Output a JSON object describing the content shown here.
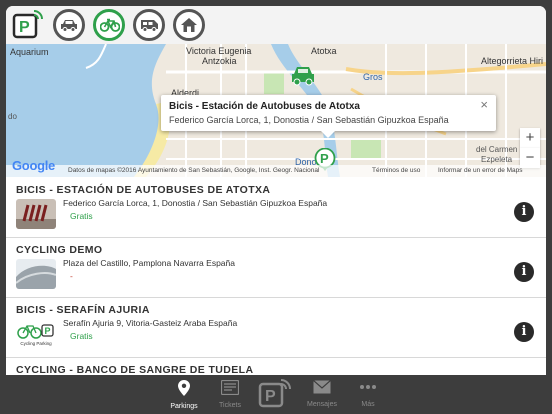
{
  "toolbar": {
    "categories": [
      {
        "name": "car",
        "active": false
      },
      {
        "name": "bicycle",
        "active": true
      },
      {
        "name": "van",
        "active": false
      },
      {
        "name": "home",
        "active": false
      }
    ]
  },
  "map": {
    "labels": {
      "aquarium": "Aquarium",
      "victoria_eugenia": "Victoria Eugenia",
      "antzokia": "Antzokia",
      "alderdi": "Alderdi",
      "gros": "Gros",
      "atotxa": "Atotxa",
      "altegorrieta": "Altegorrieta Hiri",
      "del_carmen": "del Carmen",
      "ezpeleta": "Ezpeleta",
      "do": "do",
      "donostia": "Dono"
    },
    "info_window": {
      "title": "Bicis - Estación de Autobuses de Atotxa",
      "address": "Federico García Lorca, 1, Donostia / San Sebastián Gipuzkoa España",
      "close": "×"
    },
    "zoom_in": "+",
    "zoom_out": "−",
    "google": "Google",
    "attribution": "Datos de mapas ©2016 Ayuntamiento de San Sebastián, Google, Inst. Geogr. Nacional",
    "terms": "Términos de uso",
    "report": "Informar de un error de Maps"
  },
  "parkings": [
    {
      "title": "BICIS - ESTACIÓN DE AUTOBUSES DE ATOTXA",
      "address": "Federico García Lorca, 1, Donostia / San Sebastián Gipuzkoa España",
      "price": "Gratis"
    },
    {
      "title": "CYCLING DEMO",
      "address": "Plaza del Castillo, Pamplona Navarra España",
      "price": "-"
    },
    {
      "title": "BICIS - SERAFÍN AJURIA",
      "address": "Serafín Ajuria 9, Vitoria-Gasteiz Araba España",
      "price": "Gratis"
    },
    {
      "title": "CYCLING - BANCO DE SANGRE DE TUDELA",
      "address": "",
      "price": ""
    }
  ],
  "thumb3_text": "Cycling Parking",
  "nav": {
    "tabs": [
      {
        "label": "Parkings",
        "active": true
      },
      {
        "label": "Tickets",
        "active": false
      },
      {
        "label": "",
        "active": false
      },
      {
        "label": "Mensajes",
        "active": false
      },
      {
        "label": "Más",
        "active": false
      }
    ]
  },
  "colors": {
    "accent": "#2fa04b",
    "background": "#3d3d3d",
    "water": "#a6cde9"
  }
}
